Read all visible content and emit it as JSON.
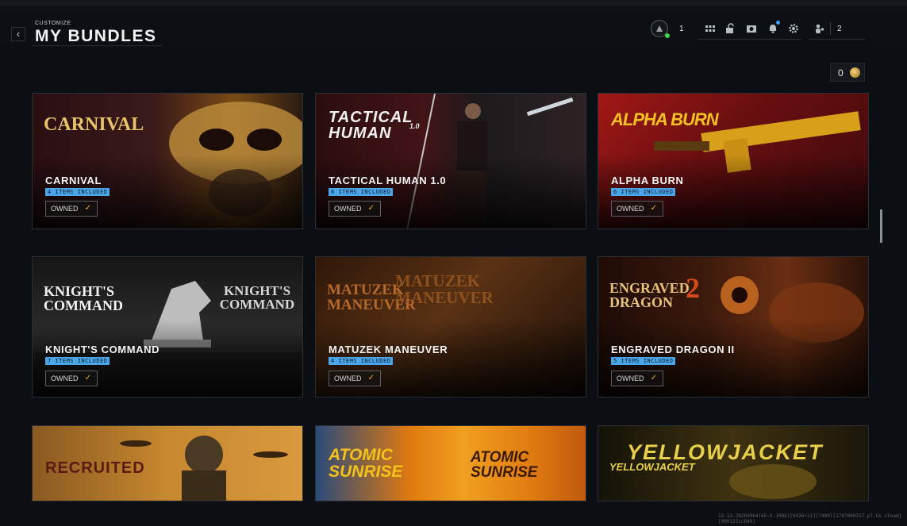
{
  "header": {
    "breadcrumb": "CUSTOMIZE",
    "title": "MY BUNDLES",
    "back_glyph": "‹",
    "level": "1",
    "party_count": "2"
  },
  "hud_icons": [
    "grid-icon",
    "lock-icon",
    "camera-icon",
    "bell-icon",
    "gear-icon",
    "party-icon"
  ],
  "currency": {
    "value": "0",
    "icon": "cod-points-icon"
  },
  "bundles": [
    {
      "name": "CARNIVAL",
      "items": "4 ITEMS INCLUDED",
      "status": "OWNED",
      "logo": "CARNIVAL",
      "colors": [
        "#2a0e12",
        "#7a4a16"
      ]
    },
    {
      "name": "TACTICAL HUMAN 1.0",
      "items": "6 ITEMS INCLUDED",
      "status": "OWNED",
      "logo": "TACTICAL HUMAN",
      "logo_sup": "1.0",
      "colors": [
        "#2b0d0e",
        "#5b2a1e"
      ]
    },
    {
      "name": "ALPHA BURN",
      "items": "6 ITEMS INCLUDED",
      "status": "OWNED",
      "logo": "ALPHA BURN",
      "colors": [
        "#6b0f10",
        "#d8a01a"
      ]
    },
    {
      "name": "KNIGHT'S COMMAND",
      "items": "7 ITEMS INCLUDED",
      "status": "OWNED",
      "logo": "KNIGHT'S COMMAND",
      "colors": [
        "#101010",
        "#3a3a3a"
      ]
    },
    {
      "name": "MATUZEK MANEUVER",
      "items": "4 ITEMS INCLUDED",
      "status": "OWNED",
      "logo": "MATUZEK MANEUVER",
      "colors": [
        "#241206",
        "#5a3214"
      ]
    },
    {
      "name": "ENGRAVED DRAGON II",
      "items": "5 ITEMS INCLUDED",
      "status": "OWNED",
      "logo": "ENGRAVED DRAGON",
      "logo_sup": "2",
      "colors": [
        "#1e0c06",
        "#6a2e12"
      ]
    },
    {
      "name": "",
      "logo": "RECRUITED",
      "colors": [
        "#c7882e",
        "#4a2c12"
      ]
    },
    {
      "name": "",
      "logo": "ATOMIC SUNRISE",
      "colors": [
        "#e07a10",
        "#1a3a6a"
      ]
    },
    {
      "name": "",
      "logo": "YELLOWJACKET",
      "colors": [
        "#141208",
        "#3e3210"
      ]
    }
  ],
  "footer": {
    "text": "12.13.28266964(65-0.1086)[8426+11][7400][1787000317.pl.Gs.steam][000122cc660]"
  }
}
